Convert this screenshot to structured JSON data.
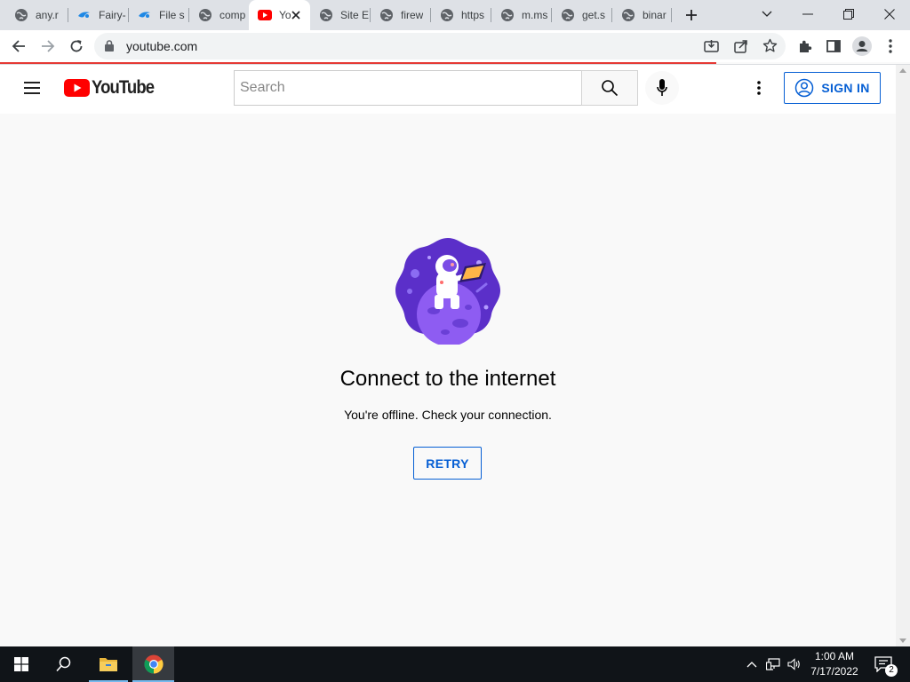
{
  "browser": {
    "tabs": [
      {
        "title": "any.r",
        "icon": "globe-icon"
      },
      {
        "title": "Fairy-",
        "icon": "fairy-icon"
      },
      {
        "title": "File s",
        "icon": "fairy-icon"
      },
      {
        "title": "comp",
        "icon": "globe-icon"
      },
      {
        "title": "Yo",
        "icon": "youtube-icon",
        "active": true
      },
      {
        "title": "Site E",
        "icon": "globe-icon"
      },
      {
        "title": "firew",
        "icon": "globe-icon"
      },
      {
        "title": "https",
        "icon": "globe-icon"
      },
      {
        "title": "m.ms",
        "icon": "globe-icon"
      },
      {
        "title": "get.s",
        "icon": "globe-icon"
      },
      {
        "title": "binar",
        "icon": "globe-icon"
      }
    ],
    "url": "youtube.com"
  },
  "youtube": {
    "logo_text": "YouTube",
    "search_placeholder": "Search",
    "signin_label": "SIGN IN"
  },
  "offline": {
    "title": "Connect to the internet",
    "message": "You're offline. Check your connection.",
    "retry_label": "RETRY"
  },
  "taskbar": {
    "time": "1:00 AM",
    "date": "7/17/2022",
    "notification_count": "2"
  },
  "colors": {
    "youtube_red": "#ff0000",
    "link_blue": "#065fd4",
    "illustration_purple": "#6a3fd6"
  }
}
